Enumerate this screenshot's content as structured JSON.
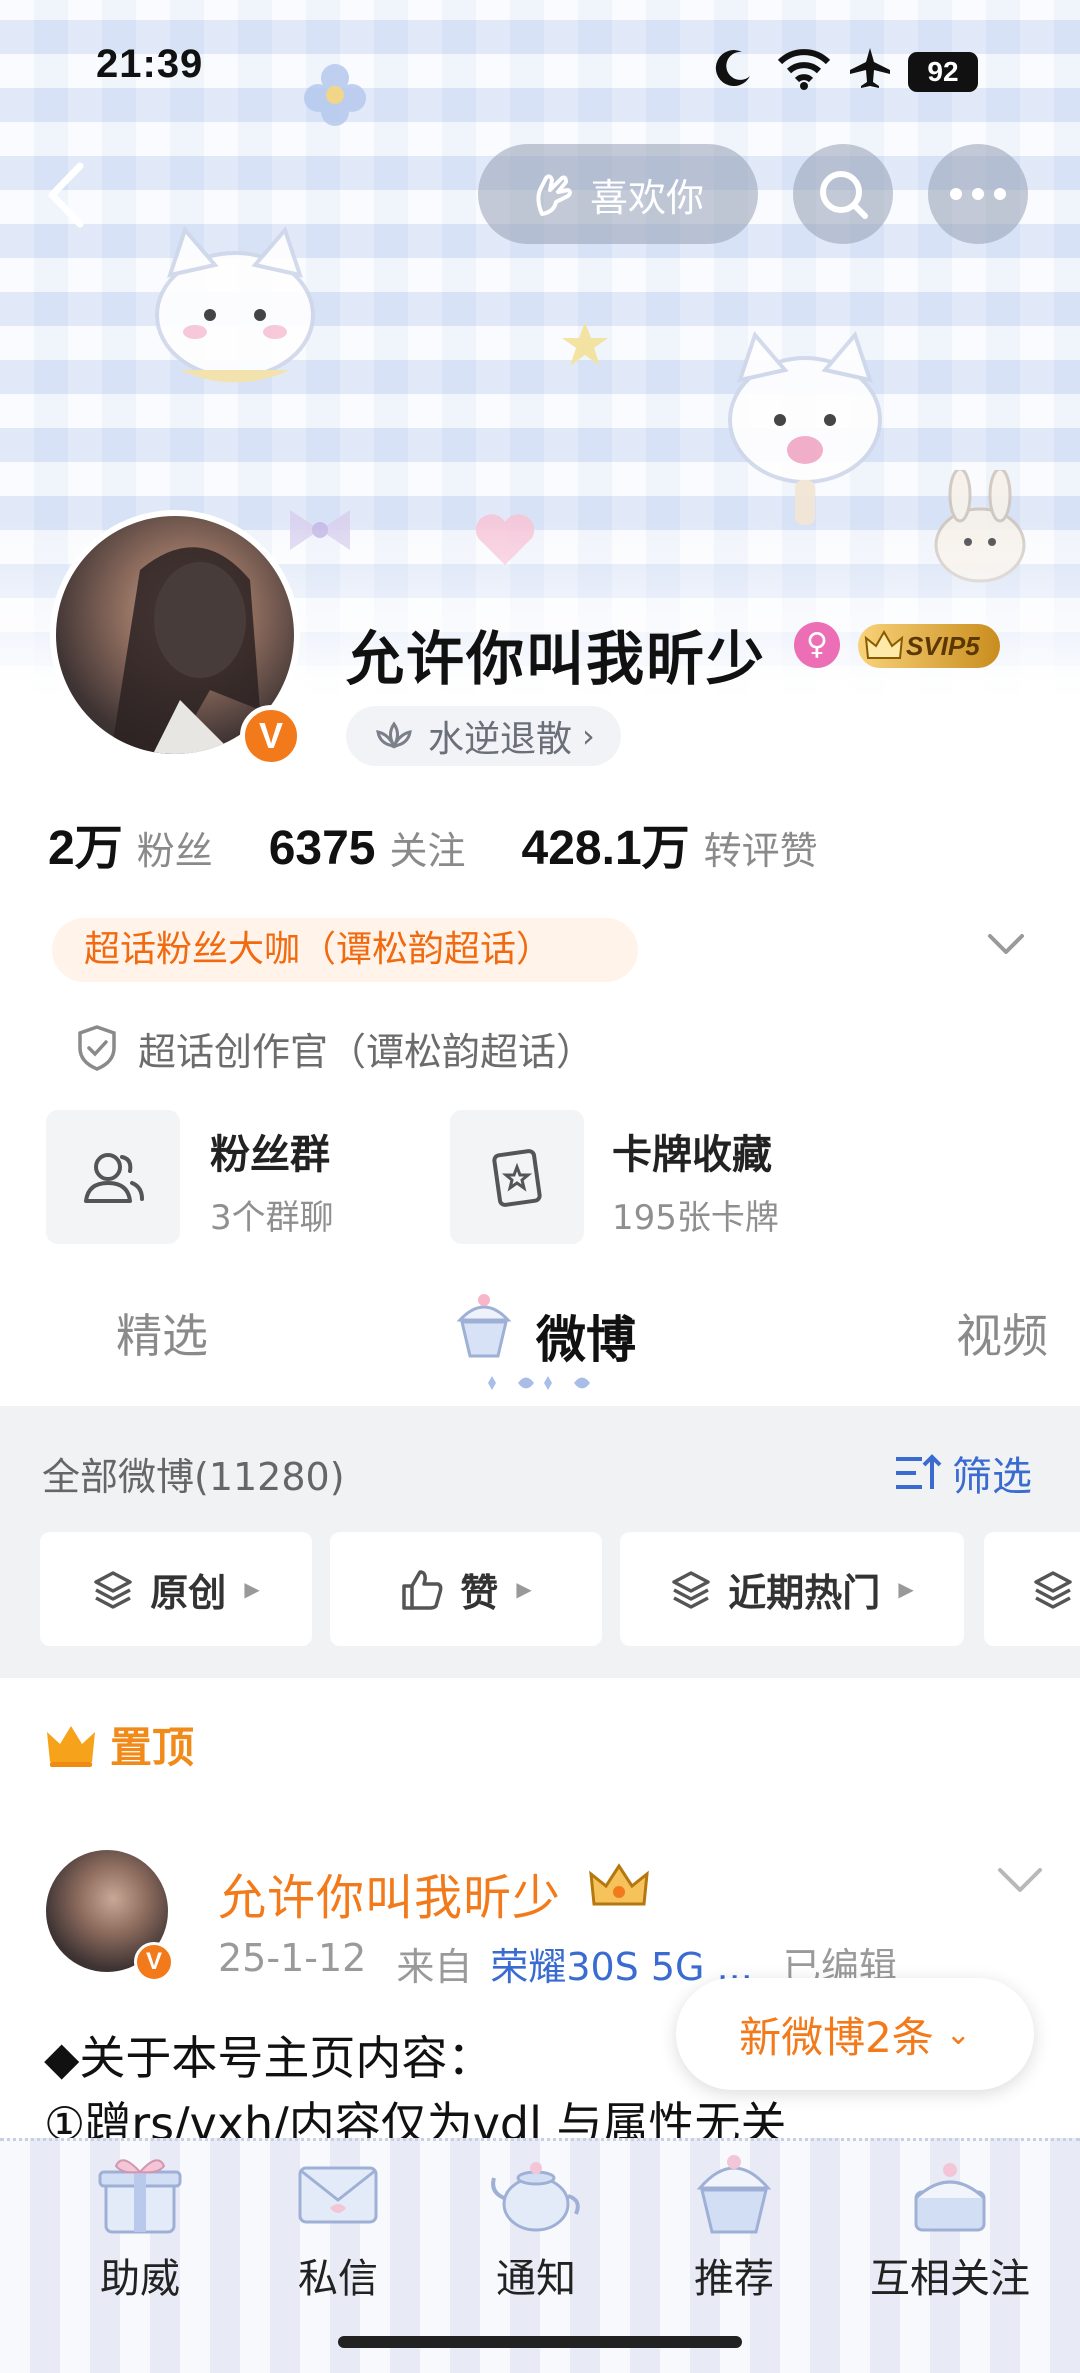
{
  "status_bar": {
    "time": "21:39",
    "battery": "92",
    "icons": [
      "moon-icon",
      "wifi-icon",
      "airplane-icon",
      "battery-icon"
    ]
  },
  "nav": {
    "back_icon": "chevron-left-icon",
    "like_label": "喜欢你",
    "like_icon": "hand-icon",
    "search_icon": "search-icon",
    "more_icon": "more-dots-icon"
  },
  "profile": {
    "username": "允许你叫我昕少",
    "verified_mark": "V",
    "gender_icon": "female-icon",
    "svip_label": "SVIP5",
    "ip_tag": "水逆退散",
    "ip_tag_arrow": "›"
  },
  "counts": [
    {
      "num": "2万",
      "label": "粉丝"
    },
    {
      "num": "6375",
      "label": "关注"
    },
    {
      "num": "428.1万",
      "label": "转评赞"
    }
  ],
  "badges": {
    "super_fan": "超话粉丝大咖（谭松韵超话）",
    "creator": "超话创作官（谭松韵超话）"
  },
  "features": [
    {
      "title": "粉丝群",
      "sub": "3个群聊",
      "icon": "users-icon"
    },
    {
      "title": "卡牌收藏",
      "sub": "195张卡牌",
      "icon": "card-icon"
    }
  ],
  "tabs": [
    "精选",
    "微博",
    "视频"
  ],
  "feed_header": {
    "all_weibo": "全部微博(11280)",
    "filter_label": "筛选"
  },
  "chips": [
    {
      "label": "原创",
      "arrow": "▶"
    },
    {
      "label": "赞",
      "arrow": "▶"
    },
    {
      "label": "近期热门",
      "arrow": "▶"
    }
  ],
  "pinned_label": "置顶",
  "post": {
    "author": "允许你叫我昕少",
    "verified_mark": "V",
    "date": "25-1-12",
    "from": "来自",
    "device": "荣耀30S 5G ...",
    "edited": "已编辑",
    "line1": "◆关于本号主页内容：",
    "line2": "①蹭rs/vxh/内容仅为vdl 与属性无关"
  },
  "new_posts": {
    "label": "新微博2条",
    "chevron": "⌄"
  },
  "bottom_bar": [
    {
      "label": "助威",
      "icon": "gift-icon"
    },
    {
      "label": "私信",
      "icon": "envelope-icon"
    },
    {
      "label": "通知",
      "icon": "teapot-icon"
    },
    {
      "label": "推荐",
      "icon": "cupcake-icon"
    },
    {
      "label": "互相关注",
      "icon": "cake-icon"
    }
  ],
  "colors": {
    "accent_orange": "#f27a1a",
    "link_blue": "#3a6bd0",
    "banner_bg": "#e6ecf8"
  }
}
